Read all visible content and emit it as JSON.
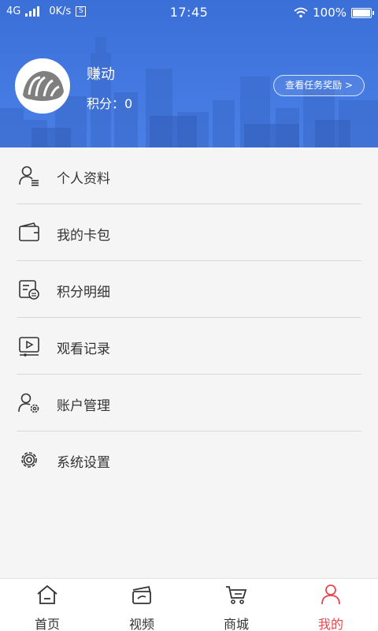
{
  "status_bar": {
    "network": "4G",
    "speed": "0K/s",
    "s_badge": "S",
    "time": "17:45",
    "battery": "100%"
  },
  "profile": {
    "name": "赚动",
    "points_label": "积分：0",
    "reward_button": "查看任务奖励 >"
  },
  "menu": [
    {
      "label": "个人资料",
      "icon": "user-profile-icon"
    },
    {
      "label": "我的卡包",
      "icon": "wallet-icon"
    },
    {
      "label": "积分明细",
      "icon": "points-detail-icon"
    },
    {
      "label": "观看记录",
      "icon": "watch-history-icon"
    },
    {
      "label": "账户管理",
      "icon": "account-settings-icon"
    },
    {
      "label": "系统设置",
      "icon": "gear-icon"
    }
  ],
  "tabs": [
    {
      "label": "首页",
      "icon": "home-icon",
      "active": false
    },
    {
      "label": "视频",
      "icon": "video-icon",
      "active": false
    },
    {
      "label": "商城",
      "icon": "cart-icon",
      "active": false
    },
    {
      "label": "我的",
      "icon": "person-icon",
      "active": true
    }
  ],
  "colors": {
    "header_blue": "#3a6fd8",
    "active_tab": "#e8474f",
    "text": "#333333"
  }
}
